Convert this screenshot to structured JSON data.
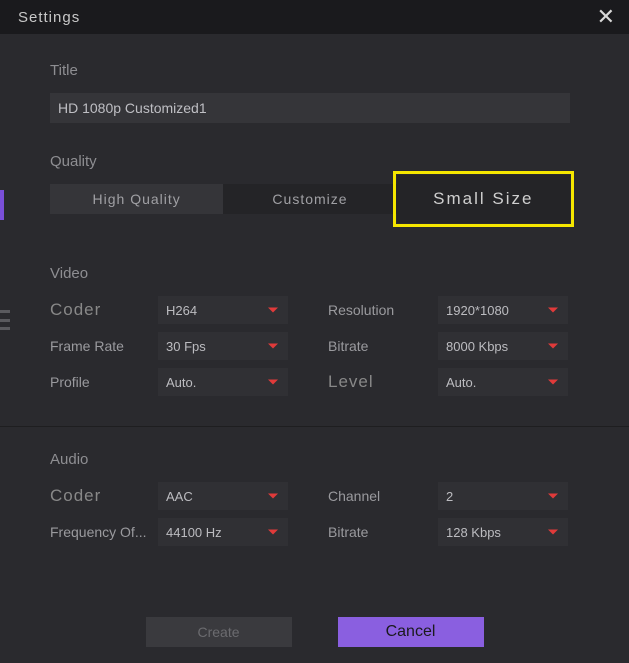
{
  "header": {
    "title": "Settings"
  },
  "title_section": {
    "label": "Title",
    "value": "HD 1080p Customized1"
  },
  "quality": {
    "label": "Quality",
    "options": {
      "high": "High Quality",
      "custom": "Customize",
      "small": "Small Size"
    }
  },
  "video": {
    "label": "Video",
    "coder": {
      "label": "Coder",
      "value": "H264"
    },
    "resolution": {
      "label": "Resolution",
      "value": "1920*1080"
    },
    "framerate": {
      "label": "Frame Rate",
      "value": "30 Fps"
    },
    "bitrate": {
      "label": "Bitrate",
      "value": "8000 Kbps"
    },
    "profile": {
      "label": "Profile",
      "value": "Auto."
    },
    "level": {
      "label": "Level",
      "value": "Auto."
    }
  },
  "audio": {
    "label": "Audio",
    "coder": {
      "label": "Coder",
      "value": "AAC"
    },
    "channel": {
      "label": "Channel",
      "value": "2"
    },
    "frequency": {
      "label": "Frequency Of...",
      "value": "44100 Hz"
    },
    "bitrate": {
      "label": "Bitrate",
      "value": "128 Kbps"
    }
  },
  "footer": {
    "create": "Create",
    "cancel": "Cancel"
  }
}
